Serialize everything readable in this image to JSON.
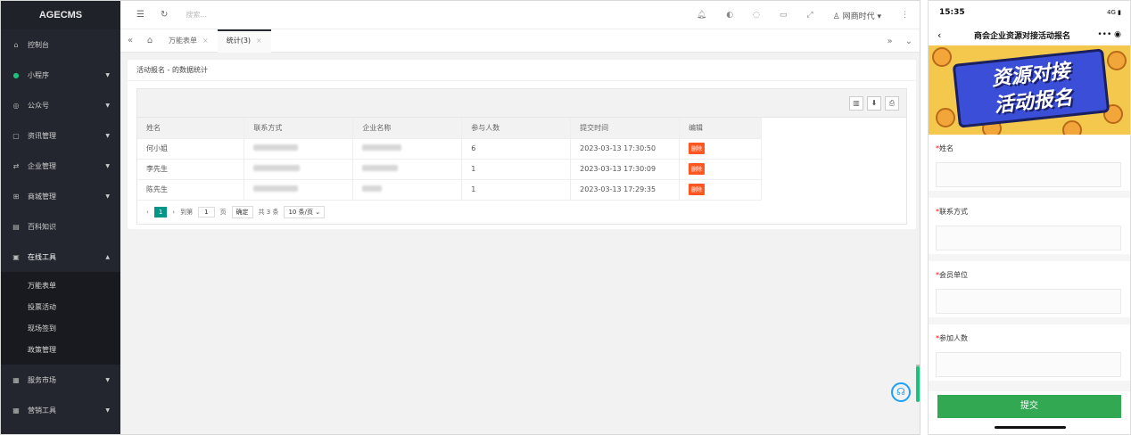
{
  "sidebar": {
    "brand": "AGECMS",
    "items": [
      {
        "label": "控制台",
        "icon": "home-icon"
      },
      {
        "label": "小程序",
        "icon": "miniprogram-icon"
      },
      {
        "label": "公众号",
        "icon": "wechat-icon"
      },
      {
        "label": "资讯管理",
        "icon": "news-icon"
      },
      {
        "label": "企业管理",
        "icon": "enterprise-icon"
      },
      {
        "label": "商城管理",
        "icon": "cart-icon"
      },
      {
        "label": "百科知识",
        "icon": "book-icon"
      },
      {
        "label": "在线工具",
        "icon": "tools-icon"
      },
      {
        "label": "服务市场",
        "icon": "market-icon"
      },
      {
        "label": "营销工具",
        "icon": "marketing-icon"
      }
    ],
    "subitems": [
      "万能表单",
      "投票活动",
      "现场签到",
      "政策管理"
    ]
  },
  "topbar": {
    "search_placeholder": "搜索...",
    "user": "网商时代"
  },
  "tabs": [
    {
      "label": "万能表单"
    },
    {
      "label": "统计(3)"
    }
  ],
  "content": {
    "title": "活动报名 - 的数据统计",
    "columns": [
      "姓名",
      "联系方式",
      "企业名称",
      "参与人数",
      "提交时间",
      "编辑"
    ],
    "rows": [
      {
        "name": "何小姐",
        "count": "6",
        "time": "2023-03-13 17:30:50",
        "action": "删除"
      },
      {
        "name": "李先生",
        "count": "1",
        "time": "2023-03-13 17:30:09",
        "action": "删除"
      },
      {
        "name": "陈先生",
        "count": "1",
        "time": "2023-03-13 17:29:35",
        "action": "删除"
      }
    ],
    "pager": {
      "current": "1",
      "goto_label": "到第",
      "goto_value": "1",
      "page_label": "页",
      "confirm": "确定",
      "total": "共 3 条",
      "per_page": "10 条/页"
    }
  },
  "phone": {
    "time": "15:35",
    "signal": "4G",
    "title": "商会企业资源对接活动报名",
    "banner_line1": "资源对接",
    "banner_line2": "活动报名",
    "fields": [
      {
        "label": "姓名"
      },
      {
        "label": "联系方式"
      },
      {
        "label": "会员单位"
      },
      {
        "label": "参加人数"
      }
    ],
    "submit": "提交"
  },
  "colors": {
    "sidebar_bg": "#23262e",
    "accent_green": "#009688",
    "delete_orange": "#ff5722",
    "submit_green": "#32a853"
  }
}
